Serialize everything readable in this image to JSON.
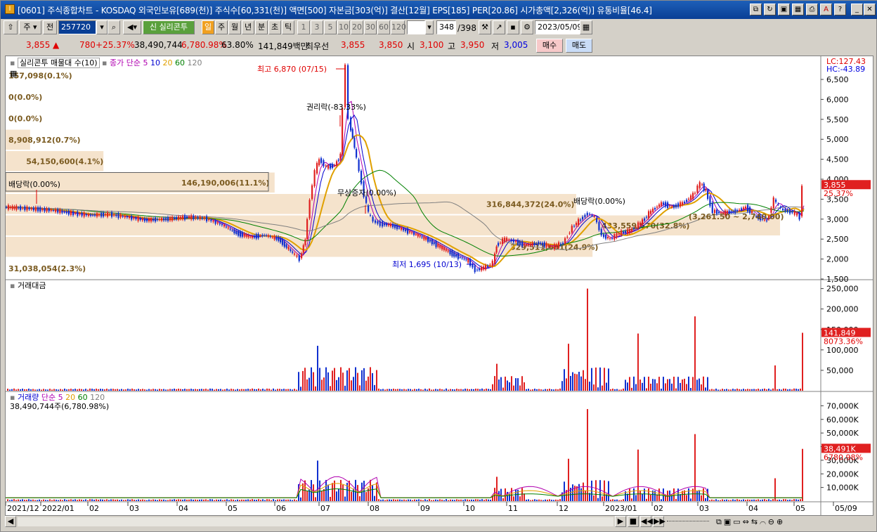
{
  "title": "[0601] 주식종합차트 - KOSDAQ 외국인보유[689(천)] 주식수[60,331(천)] 액면[500] 자본금[303(억)] 결산[12월] EPS[185] PER[20.86] 시가총액[2,326(억)] 유통비율[46.4]",
  "toolbar": {
    "market": "주",
    "mode": "전",
    "code": "257720",
    "stock_name": "실리콘투",
    "periods": [
      "일",
      "주",
      "월",
      "년",
      "분",
      "초",
      "틱"
    ],
    "minutes": [
      "1",
      "3",
      "5",
      "10",
      "20",
      "30",
      "60",
      "120"
    ],
    "count": "348",
    "total": "/398",
    "date": "2023/05/09"
  },
  "quote": {
    "price": "3,855",
    "arrow": "▲",
    "change": "780",
    "change_pct": "+25.37%",
    "volume": "38,490,744",
    "volume_pct": "6,780.98%",
    "turnover_pct": "63.80%",
    "amount": "141,849백만",
    "best": "최우선",
    "ask": "3,855",
    "bid": "3,850",
    "open_label": "시",
    "open": "3,100",
    "high_label": "고",
    "high": "3,950",
    "low_label": "저",
    "low": "3,005",
    "buy": "매수",
    "sell": "매도"
  },
  "price_panel": {
    "legend_title": "실리콘투 매물대 수(10)",
    "ma_title": "종가 단순",
    "ma_periods": [
      "5",
      "10",
      "20",
      "60",
      "120"
    ],
    "lc": "LC:127.43",
    "hc": "HC:-43.89",
    "current_price": "3,855",
    "current_pct": "25.37%",
    "annotations": {
      "high": "최고 6,870 (07/15)",
      "low": "최저 1,695 (10/13)",
      "rights": "권리락(-83.33%)",
      "bonus": "무상증자(0.00%)",
      "div1": "배당락(0.00%)",
      "div2": "배당락(0.00%)",
      "range": "(3,261.50 ~ 2,740.00)"
    },
    "volume_profile": [
      {
        "label": "157,098(0.1%)",
        "frac": 0.0
      },
      {
        "label": "0(0.0%)",
        "frac": 0.0
      },
      {
        "label": "0(0.0%)",
        "frac": 0.0
      },
      {
        "label": "8,908,912(0.7%)",
        "frac": 0.03
      },
      {
        "label": "54,150,600(4.1%)",
        "frac": 0.12
      },
      {
        "label": "146,190,006(11.1%)",
        "frac": 0.33
      },
      {
        "label": "316,844,372(24.0%)",
        "frac": 0.7
      },
      {
        "label": "433,559,670(32.8%)",
        "frac": 0.95
      },
      {
        "label": "329,511,601(24.9%)",
        "frac": 0.72
      },
      {
        "label": "31,038,054(2.3%)",
        "frac": 0.0
      }
    ],
    "y_ticks": [
      "6,500",
      "6,000",
      "5,500",
      "5,000",
      "4,500",
      "4,000",
      "3,500",
      "3,000",
      "2,500",
      "2,000",
      "1,500"
    ]
  },
  "amount_panel": {
    "title": "거래대금",
    "current": "141,849",
    "current_pct": "8073.36%",
    "y_ticks": [
      "250,000",
      "200,000",
      "150,000",
      "100,000",
      "50,000"
    ]
  },
  "volume_panel": {
    "title": "거래량",
    "ma_title": "단순",
    "ma_periods": [
      "5",
      "20",
      "60",
      "120"
    ],
    "readout": "38,490,744주(6,780.98%)",
    "current": "38,491K",
    "current_pct": "6780.98%",
    "y_ticks": [
      "70,000K",
      "60,000K",
      "50,000K",
      "40,000K",
      "30,000K",
      "20,000K",
      "10,000K"
    ]
  },
  "x_labels": [
    "2021/12",
    "2022/01",
    "02",
    "03",
    "04",
    "05",
    "06",
    "07",
    "08",
    "09",
    "10",
    "11",
    "12",
    "2023/01",
    "02",
    "03",
    "04",
    "05",
    "05/09"
  ],
  "chart_data": {
    "type": "line",
    "x": [
      "2021/12",
      "2022/01",
      "02",
      "03",
      "04",
      "05",
      "06",
      "07",
      "08",
      "09",
      "10",
      "11",
      "12",
      "2023/01",
      "02",
      "03",
      "04",
      "05"
    ],
    "series": [
      {
        "values": [
          3300,
          3200,
          3000,
          2950,
          3000,
          2600,
          2200,
          4600,
          3000,
          2400,
          1800,
          2400,
          2600,
          3000,
          3400,
          3700,
          3200,
          3855
        ]
      }
    ],
    "ylim": [
      1500,
      6870
    ]
  }
}
